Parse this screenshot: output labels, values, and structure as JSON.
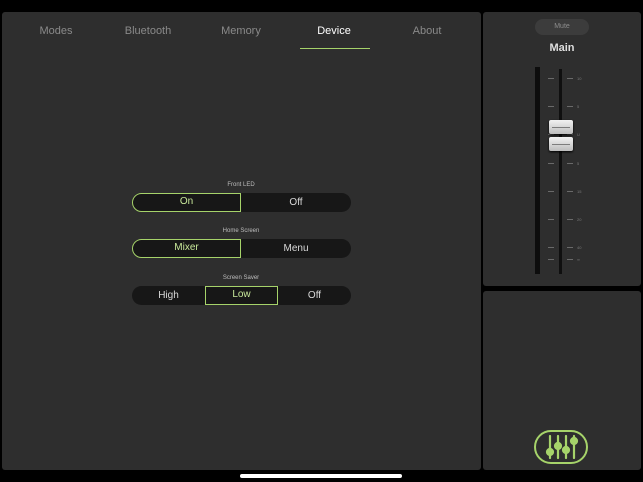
{
  "tabs": [
    {
      "label": "Modes"
    },
    {
      "label": "Bluetooth"
    },
    {
      "label": "Memory"
    },
    {
      "label": "Device"
    },
    {
      "label": "About"
    }
  ],
  "settings": {
    "front_led": {
      "label": "Front LED",
      "options": [
        "On",
        "Off"
      ],
      "selected": "On"
    },
    "home_screen": {
      "label": "Home Screen",
      "options": [
        "Mixer",
        "Menu"
      ],
      "selected": "Mixer"
    },
    "screen_saver": {
      "label": "Screen Saver",
      "options": [
        "High",
        "Low",
        "Off"
      ],
      "selected": "Low"
    }
  },
  "channel": {
    "mute_label": "Mute",
    "title": "Main",
    "scale": [
      "10",
      "5",
      "U",
      "5",
      "15",
      "20",
      "40",
      "∞"
    ]
  },
  "icons": {
    "mixer": "mixer-sliders-icon"
  },
  "colors": {
    "accent": "#a6d36a",
    "panel": "#2e2e2e",
    "background": "#000000"
  }
}
